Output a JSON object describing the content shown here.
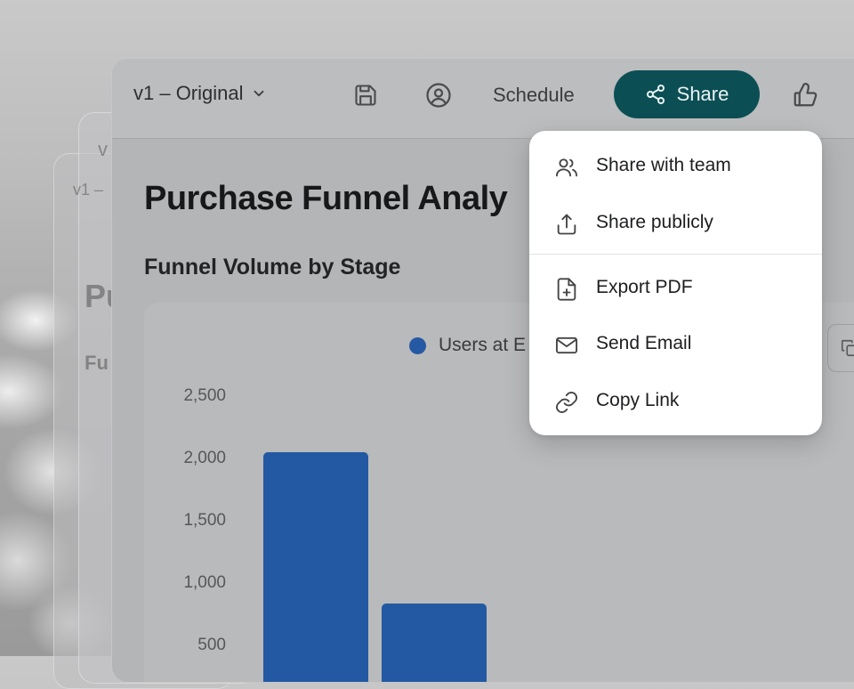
{
  "toolbar": {
    "version_label": "v1 – Original",
    "schedule_label": "Schedule",
    "share_label": "Share"
  },
  "background": {
    "ghost_version_1": "v",
    "ghost_version_2": "v1 –",
    "ghost_title": "Pu",
    "ghost_sub": "Fu"
  },
  "page": {
    "title": "Purchase Funnel Analy",
    "chart_title": "Funnel Volume by Stage"
  },
  "chart_data": {
    "type": "bar",
    "legend": "Users at E",
    "y_ticks": [
      "2,500",
      "2,000",
      "1,500",
      "1,000",
      "500"
    ],
    "ylim": [
      0,
      2500
    ],
    "values": [
      2060,
      840
    ],
    "color": "#2259a2"
  },
  "share_menu": {
    "items": [
      {
        "label": "Share with team",
        "icon": "users-icon"
      },
      {
        "label": "Share publicly",
        "icon": "upload-icon"
      },
      {
        "label": "Export PDF",
        "icon": "file-plus-icon"
      },
      {
        "label": "Send Email",
        "icon": "mail-icon"
      },
      {
        "label": "Copy Link",
        "icon": "link-icon"
      }
    ]
  },
  "colors": {
    "accent": "#0b4f55",
    "bar": "#2259a2"
  }
}
